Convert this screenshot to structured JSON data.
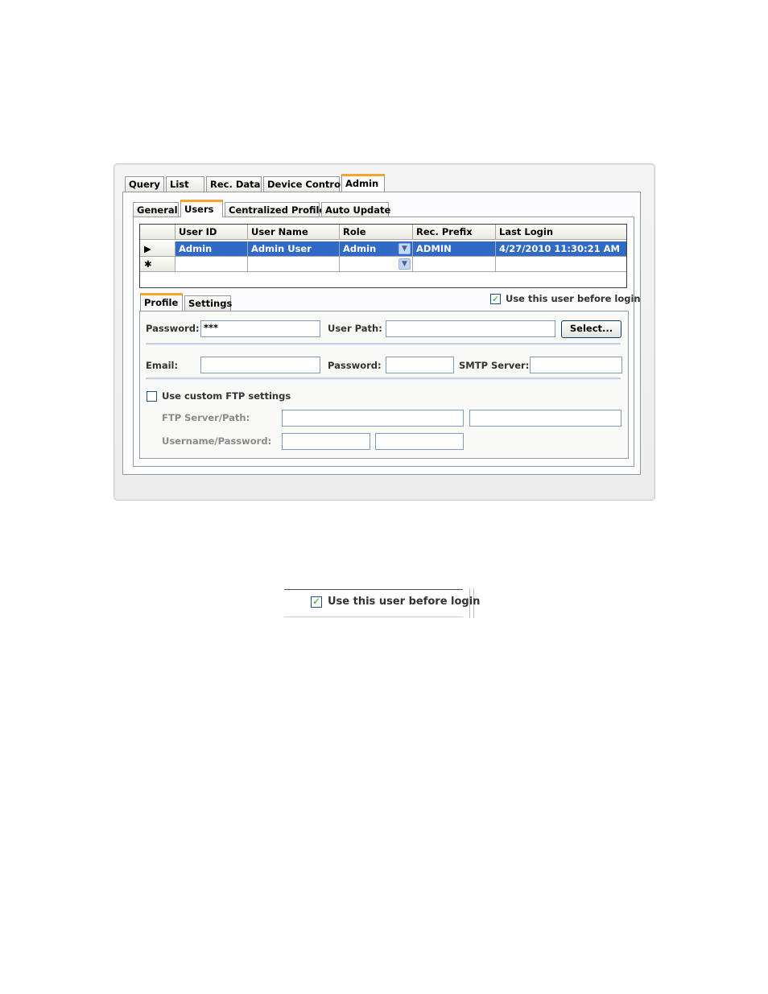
{
  "main_tabs": [
    "Query",
    "List",
    "Rec. Data",
    "Device Control",
    "Admin"
  ],
  "admin_tabs": [
    "General",
    "Users",
    "Centralized Profile",
    "Auto Update"
  ],
  "grid": {
    "columns": [
      "User ID",
      "User Name",
      "Role",
      "Rec. Prefix",
      "Last Login"
    ],
    "rows": [
      {
        "marker": "▶",
        "user_id": "Admin",
        "user_name": "Admin User",
        "role": "Admin",
        "rec_prefix": "ADMIN",
        "last_login": "4/27/2010 11:30:21 AM"
      },
      {
        "marker": "✱",
        "user_id": "",
        "user_name": "",
        "role": "",
        "rec_prefix": "",
        "last_login": ""
      }
    ]
  },
  "profile_tabs": [
    "Profile",
    "Settings"
  ],
  "use_user_before_login": {
    "label": "Use this user before login",
    "checked": true
  },
  "profile": {
    "password_label": "Password:",
    "password_value": "***",
    "user_path_label": "User Path:",
    "user_path_value": "",
    "select_button": "Select...",
    "email_label": "Email:",
    "email_value": "",
    "smtp_password_label": "Password:",
    "smtp_password_value": "",
    "smtp_server_label": "SMTP Server:",
    "smtp_server_value": "",
    "custom_ftp": {
      "label": "Use custom FTP settings",
      "checked": false
    },
    "ftp_server_label": "FTP Server/Path:",
    "username_password_label": "Username/Password:"
  },
  "zoom_callout": {
    "label": "Use this user before login",
    "checked": true
  },
  "colors": {
    "active_tab_accent": "#f3a72a",
    "selection": "#316ac5",
    "check": "#21a121"
  }
}
